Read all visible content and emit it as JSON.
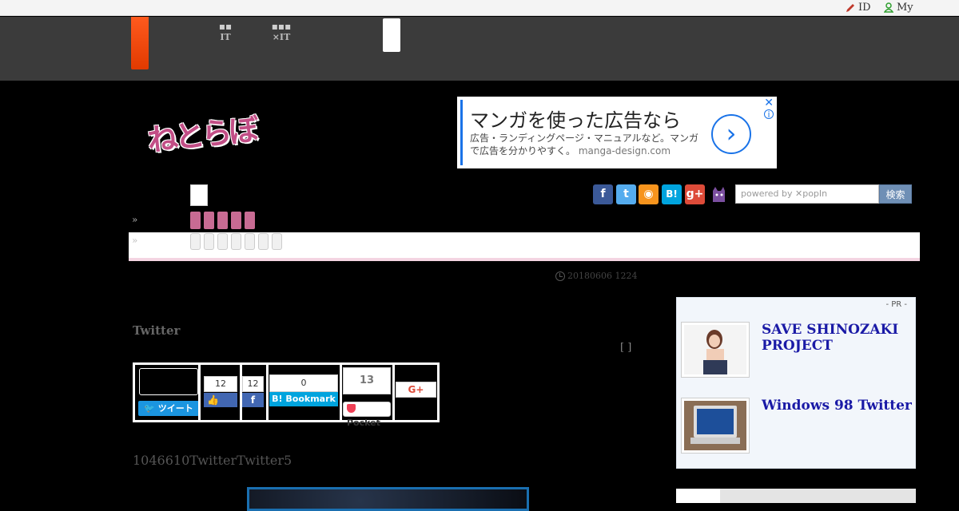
{
  "topbar": {
    "id_label": "ID",
    "my_label": "My"
  },
  "header": {
    "nav": [
      {
        "top": "",
        "bottom": "IT"
      },
      {
        "top": "",
        "bottom": "×IT"
      }
    ]
  },
  "logo": {
    "text": "ねとらぼ"
  },
  "ad": {
    "headline": "マンガを使った広告なら",
    "body": "広告・ランディングページ・マニュアルなど。マンガで広告を分かりやすく。",
    "url": "manga-design.com",
    "arrow": "›",
    "close": "✕",
    "info": "i"
  },
  "breadcrumbs": {
    "sep1": "»",
    "sep2": "»"
  },
  "social": {
    "facebook": "f",
    "twitter": "t",
    "rss": "◉",
    "hatena": "B!",
    "gplus": "g+",
    "colors": {
      "facebook": "#3b5998",
      "twitter": "#55acee",
      "rss": "#f7941d",
      "hatena": "#00a4de",
      "gplus": "#dd4b39",
      "cat": "#7b4fa0"
    }
  },
  "search": {
    "placeholder": "powered by ✕popIn",
    "button": "検索"
  },
  "article": {
    "date": "20180606 1224",
    "title": "Twitter",
    "bracket": "[ ]",
    "lead": "1046610TwitterTwitter5"
  },
  "share": {
    "tweet": "ツイート",
    "fb_like_count": "12",
    "fb_like_label": "👍",
    "fb_share_count": "12",
    "fb_share_label": "f",
    "hatena_count": "0",
    "hatena_label": "B! Bookmark",
    "pocket_count": "13",
    "pocket_label": "Pocket",
    "gplus_label": "G+"
  },
  "sidebar": {
    "pr_label": "- PR -",
    "items": [
      {
        "title": "SAVE SHINOZAKI PROJECT"
      },
      {
        "title": "Windows 98 Twitter"
      }
    ]
  }
}
